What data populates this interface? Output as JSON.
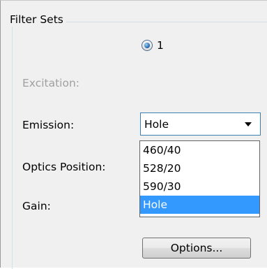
{
  "group": {
    "title": "Filter Sets"
  },
  "radio": {
    "label": "1",
    "checked": true,
    "icon": "radio-selected-icon"
  },
  "fields": {
    "excitation_label": "Excitation:",
    "emission_label": "Emission:",
    "optics_position_label": "Optics Position:",
    "gain_label": "Gain:"
  },
  "emission_select": {
    "value": "Hole",
    "icon": "chevron-down-icon",
    "options": [
      "460/40",
      "528/20",
      "590/30",
      "Hole"
    ],
    "selected_index": 3
  },
  "buttons": {
    "options_label": "Options..."
  },
  "colors": {
    "selection_highlight": "#3399ff",
    "focus_border": "#3c7fb1",
    "disabled_text": "#a0a0a0"
  }
}
